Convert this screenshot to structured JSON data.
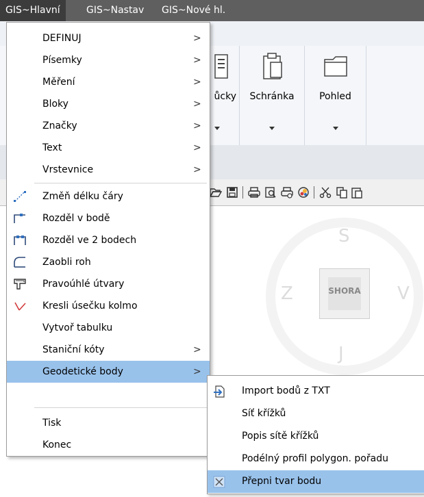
{
  "menubar": {
    "items": [
      "GIS~Hlavní",
      "GIS~Nastav",
      "GIS~Nové hl."
    ]
  },
  "ribbon": {
    "panels": [
      {
        "label": "ůcky",
        "icon": "panel-partial-icon"
      },
      {
        "label": "Schránka",
        "icon": "clipboard-icon"
      },
      {
        "label": "Pohled",
        "icon": "view-icon"
      }
    ]
  },
  "viewcube": {
    "north": "S",
    "south": "J",
    "east": "V",
    "west": "Z",
    "face": "SHORA"
  },
  "menu": {
    "items": [
      {
        "label": "DEFINUJ",
        "submenu": true
      },
      {
        "label": "Písemky",
        "submenu": true
      },
      {
        "label": "Měření",
        "submenu": true
      },
      {
        "label": "Bloky",
        "submenu": true
      },
      {
        "label": "Značky",
        "submenu": true
      },
      {
        "label": "Text",
        "submenu": true
      },
      {
        "label": "Vrstevnice",
        "submenu": true
      },
      {
        "label": "Změň délku čáry",
        "icon": "line-length-icon"
      },
      {
        "label": "Rozděl v bodě",
        "icon": "split-point-icon"
      },
      {
        "label": "Rozděl ve 2 bodech",
        "icon": "split-two-points-icon"
      },
      {
        "label": "Zaobli roh",
        "icon": "fillet-icon"
      },
      {
        "label": "Pravoúhlé útvary",
        "icon": "orthogonal-shapes-icon"
      },
      {
        "label": "Kresli úsečku kolmo",
        "icon": "perpendicular-line-icon"
      },
      {
        "label": "Vytvoř tabulku"
      },
      {
        "label": "Staniční kóty",
        "submenu": true
      },
      {
        "label": "Geodetické body",
        "submenu": true,
        "highlighted": true
      },
      {
        "label": "Tisk"
      },
      {
        "label": "Konec"
      }
    ],
    "arrow": ">"
  },
  "submenu": {
    "items": [
      {
        "label": "Import bodů z TXT",
        "icon": "import-icon"
      },
      {
        "label": "Síť křížků"
      },
      {
        "label": "Popis sítě křížků"
      },
      {
        "label": "Podélný profil polygon. pořadu"
      },
      {
        "label": "Přepni tvar bodu",
        "icon": "cross-icon",
        "highlighted": true
      }
    ]
  },
  "colors": {
    "menubar": "#5f5f5f",
    "highlight": "#99c2eb",
    "accent_red": "#d23b3b",
    "icon_blue": "#2e6fbf"
  }
}
